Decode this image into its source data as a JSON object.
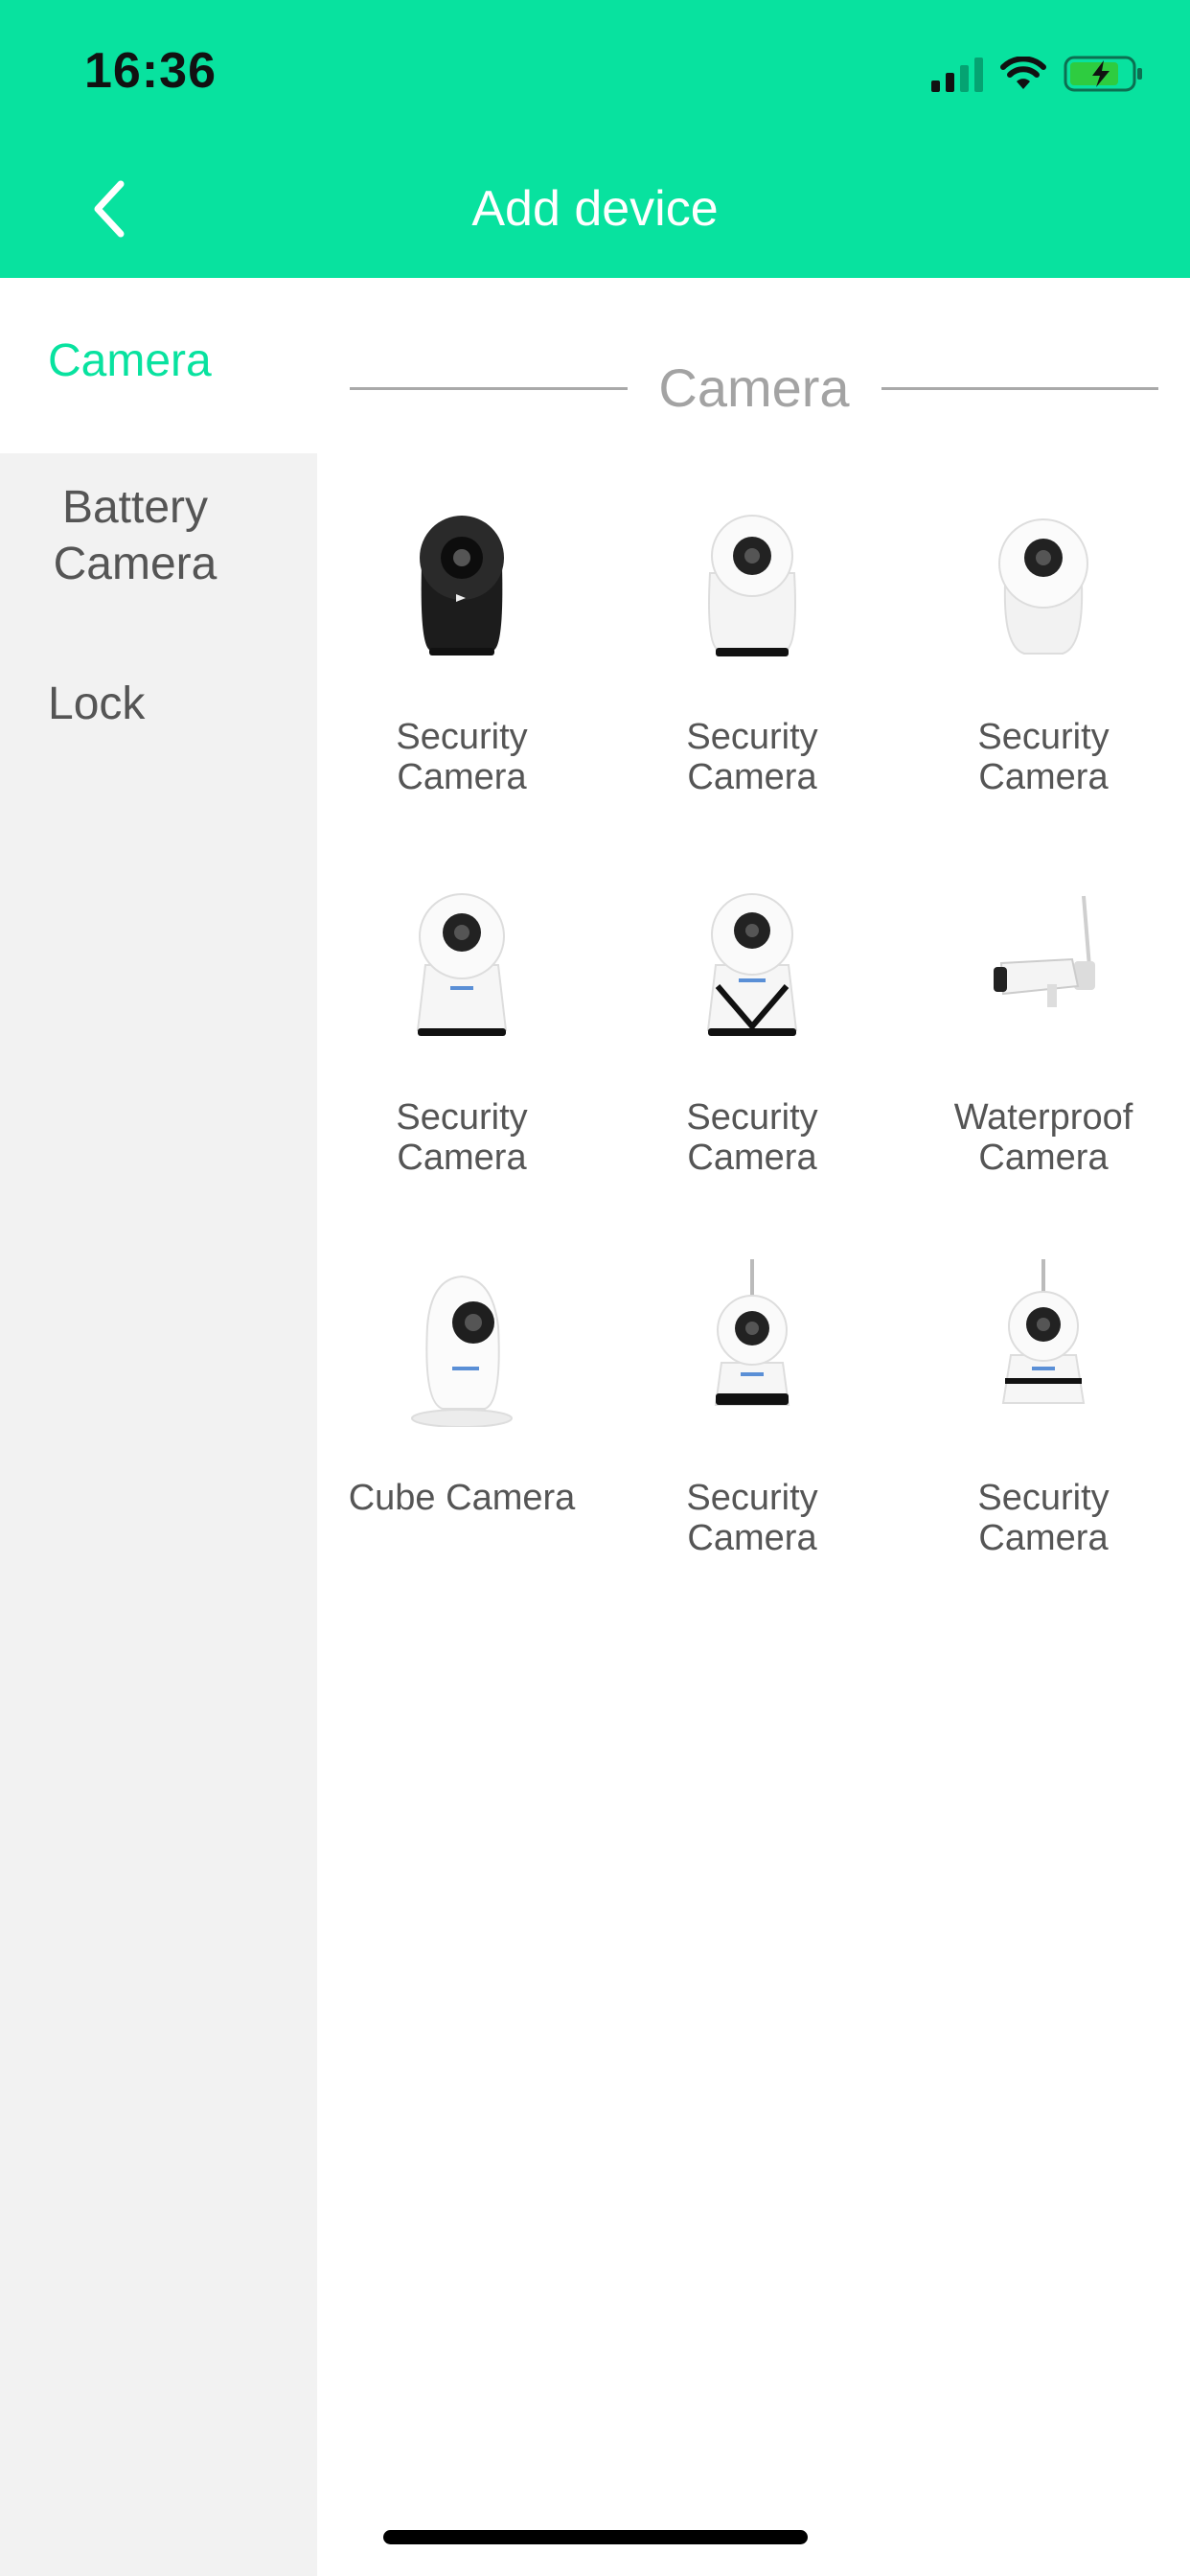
{
  "status_bar": {
    "time": "16:36"
  },
  "header": {
    "title": "Add device"
  },
  "sidebar": {
    "items": [
      {
        "label": "Camera",
        "active": true
      },
      {
        "label_line1": "Battery",
        "label_line2": "Camera",
        "active": false
      },
      {
        "label": "Lock",
        "active": false
      }
    ]
  },
  "section": {
    "title": "Camera"
  },
  "devices": [
    {
      "line1": "Security",
      "line2": "Camera",
      "icon": "ptz-camera-black-icon"
    },
    {
      "line1": "Security",
      "line2": "Camera",
      "icon": "ptz-camera-white-icon"
    },
    {
      "line1": "Security",
      "line2": "Camera",
      "icon": "dome-camera-white-icon"
    },
    {
      "line1": "Security",
      "line2": "Camera",
      "icon": "ptz-camera-cone-icon"
    },
    {
      "line1": "Security",
      "line2": "Camera",
      "icon": "ptz-camera-cone-icon"
    },
    {
      "line1": "Waterproof",
      "line2": "Camera",
      "icon": "bullet-camera-icon"
    },
    {
      "line1": "",
      "line2": "Cube Camera",
      "icon": "cube-camera-icon"
    },
    {
      "line1": "Security",
      "line2": "Camera",
      "icon": "antenna-camera-icon"
    },
    {
      "line1": "Security",
      "line2": "Camera",
      "icon": "antenna-camera-icon"
    }
  ],
  "colors": {
    "accent": "#08e29f",
    "sidebar_bg": "#f2f2f2",
    "text": "#555555"
  }
}
